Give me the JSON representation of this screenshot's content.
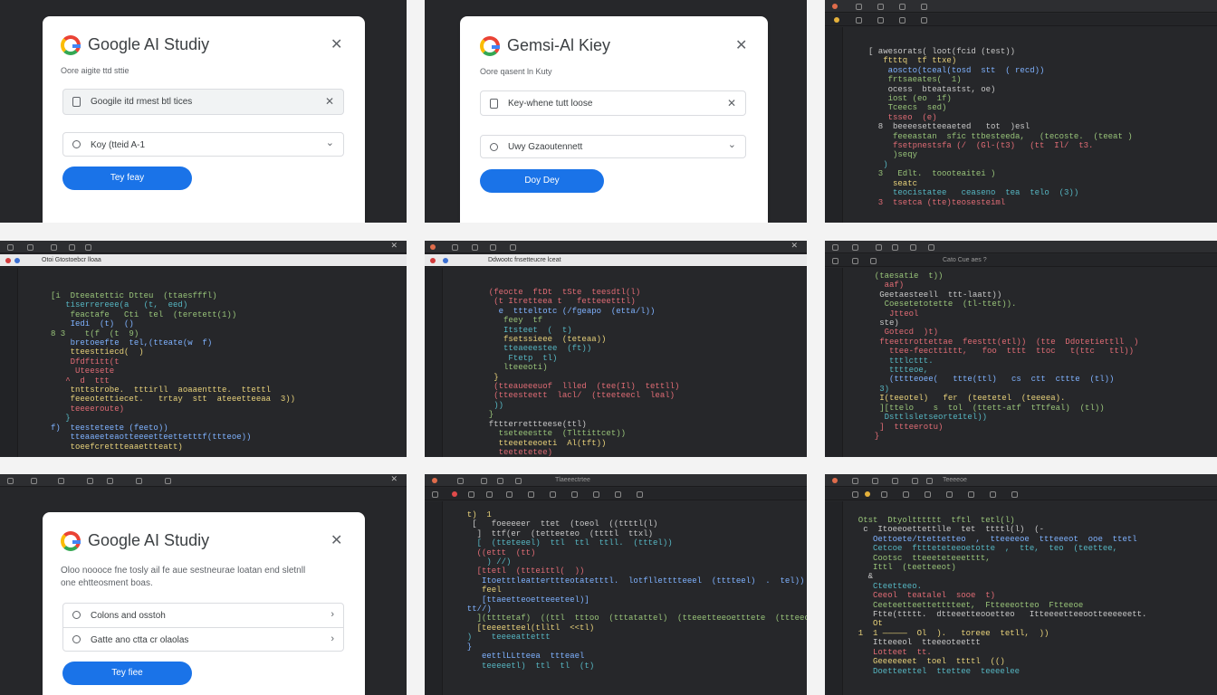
{
  "colors": {
    "accent": "#1a73e8",
    "page_bg": "#f3f3f3",
    "editor_bg": "#26272a"
  },
  "panels": {
    "p1": {
      "title": "Google AI Studiy",
      "subtitle": "Oore aigite ttd sttie",
      "field1": "Googile itd rmest btl tices",
      "field2": "Koy (tteid A-1",
      "button": "Tey feay"
    },
    "p2": {
      "title": "Gemsi-Al Kiey",
      "subtitle": "Oore qasent ln Kuty",
      "field1": "Key-whene tutt loose",
      "field2": "Uwy Gzaoutennett",
      "button": "Doy Dey"
    },
    "p3": {
      "code": [
        "[ awesorats( loot(fcid (test))",
        "   ftttq  tf ttxe)",
        "    aoscto(tceal(tosd  stt  ( recd))",
        "    frtsaeates(  1)",
        "    ocess  bteatastst, oe)",
        "    iost (eo  1f)",
        "    Tceecs  sed)",
        "    tsseo  (e)",
        "",
        "  8  beeeesetteeaeted   tot  )esl",
        "     feeeastan  sfic ttbesteeda,   (tecoste.  (teeat )",
        "     fsetpnestsfa (/  (Gl-(t3)   (tt  Il/  t3.",
        "     )seqy",
        "   )",
        "  3   Edlt.  toooteaitei )",
        "     seatc",
        "     teocistatee   ceaseno  tea  telo  (3))",
        "  3  tsetca (tte)teosesteiml"
      ]
    },
    "p4": {
      "tab": "Otoi Gtostoebcr lloaa",
      "code": [
        "[i  Dteeatettic Dtteu  (ttaesfffl)",
        "   tiserrereee(a   (t,  eed)",
        "    feactafe   Cti  tel  (teretett(1))",
        "    Iedi  (t)  ()",
        "8 3    t(f  (t  9)",
        "    bretoeefte  tel,(tteate(w  f)",
        "    tteesttiecd(  )",
        "    Dfdftitt(t",
        "     Uteesete",
        "   ^  d  ttt",
        "    tnttstrobe.  tttirll  aoaaenttte.  ttettl",
        "    feeeotettiecet.   trtay  stt  ateeetteeaa  3))",
        "    teeeeroute)",
        "   }",
        "f)  teesteteete (feeto))",
        "    tteaaeeteaotteeeetteettetttf(ttteoe))",
        "    toeefcrettteaaettteatt)"
      ]
    },
    "p5": {
      "tab": "Ddwootc fnsetteucre lceat",
      "code": [
        "  (feocte  ftDt  tSte  teesdtl(l)",
        "   (t Itretteea t   fetteeetttl)",
        "    e  ttteltotc (/fgeapo  (etta/l))",
        "     feey  tf",
        "     Itsteet  (  t)",
        "     fsetssieee  (teteaa))",
        "     tteaeeestee  (ft))",
        "      Ftetp  tl)",
        "     lteeeoti)",
        "   }",
        "   (tteaueeeuof  llled  (tee(Il)  tettll)",
        "   (tteesteett  lacl/  (tteeteecl  leal)",
        "   ))",
        "  }",
        "  fttterrettteese(ttl)",
        "",
        "    tseteeestte  (Tlttittcet))",
        "    tteeeteeoeti  Al(tft))",
        "    teetetetee)"
      ]
    },
    "p6": {
      "tab": "Cato  Cue  aes  ?",
      "code": [
        "  (taesatie  t))",
        "    aaf)",
        "   Geetaesteell  ttt-laatt))",
        "    Coesetetotette  (tl-ttet)).",
        "     Jtteol",
        "   ste)",
        "    Gotecd  )t)",
        "   fteettrottettae  feesttt(etl))  (tte  Ddotetiettll  )",
        "     ttee-feecttittt,   foo  tttt  ttoc   t(ttc   ttl))",
        "     tttlcttt.",
        "     tttteoe,",
        "     (tttteoee(   ttte(ttl)   cs  ctt  cttte  (tl))",
        "   3)",
        "",
        "   I(teeotel)   fer  (teetetel  (teeeea).",
        "   ][ttelo    s  tol  (ttett-atf  tTtfeal)  (tl))",
        "    Dsttlsletseorte1tel))",
        "   ]  ttteerotu)",
        "  }"
      ]
    },
    "p7": {
      "title": "Google AI Studiy",
      "subtitle_line1": "Oloo noooce fne tosly ail fe aue sestneurae loatan end sletnll",
      "subtitle_line2": "one ehtteosment boas.",
      "option1": "Colons and osstoh",
      "option2": "Gatte ano ctta cr olaolas",
      "button": "Tey fiee"
    },
    "p8": {
      "tab": "Tlaeeectrtee",
      "code": [
        "  t)  1",
        "   [   foeeeeer  ttet  (toeol  ((ttttl(l)",
        "    ]  ttf(er  (tetteeteo  (ttttl  ttxl)",
        "    [  (tteteeel)  ttl  ttl  ttll.  (tttel))",
        "",
        "    ((ettt  (tt)",
        "      ) //)",
        "    [ttetl  (ttteittl(  ))",
        "",
        "     Itoetttleatterttteotatetttl.  lotflletttteeel  (tttteel)  .  tel))",
        "     feel",
        "     [ttaeetteoetteeeteel)]",
        "",
        "  tt//)",
        "    ](ttttetaf)  ((ttl  tttoo  (tttatattel)  (tteeetteeoetttete  (ttteeoeeeettt)",
        "    [teeeetteel(tlltl  <<tl)",
        "  )    teeeeattettt",
        "  }",
        "     eettlLLtteea  ttteael",
        "     teeeeetl)  ttl  tl  (t)"
      ]
    },
    "p9": {
      "tab": "Teeeeoe",
      "code": [
        "  Otst  Dtyoltttttt  tftl  tetl(l)",
        "",
        "   c  Itoeeoettettlle  tet  ttttl(l)  (-",
        "     Oettoete/ttettetteo  ,  tteeeeoe  ttteeeot  ooe  ttetl",
        "     Cetcoe  fttteteteeoetotte  ,  tte,  teo  (teettee,",
        "     Cootsc  tteeeteteeetttt,",
        "     Ittl  (teetteeot)",
        "    &",
        "     Cteetteeo.",
        "     Ceeol  teatalel  sooe  t)",
        "     Ceeteetteettetttteet,  Ftteeeotteo  Ftteeoe",
        "     Ftte(ttttt.  dtteeetteooetteo   Itteeeetteeootteeeeeett.",
        "     Ot",
        "",
        "  1  1 —————  Ol  ).   toreee  tetll,  ))",
        "     Itteeeol  tteeeoteettt",
        "     Lotteet  tt.",
        "     Geeeeeeet  toel  ttttl  (()",
        "     Doetteettel  ttettee  teeeelee"
      ]
    }
  }
}
